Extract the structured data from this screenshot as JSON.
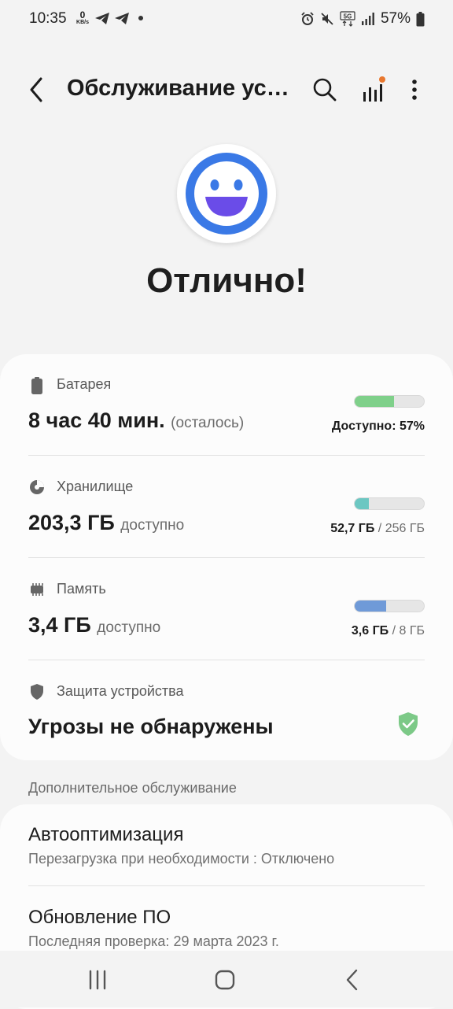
{
  "status_bar": {
    "time": "10:35",
    "net_speed": "0",
    "net_speed_unit": "KB/s",
    "network": "5G",
    "battery": "57%"
  },
  "header": {
    "title": "Обслуживание устройства",
    "stats_badge_color": "#e8772e"
  },
  "hero": {
    "status": "Отлично!",
    "face_ring_color": "#3a79e6",
    "face_mouth_color": "#6a4ce8"
  },
  "cards": {
    "battery": {
      "label": "Батарея",
      "value": "8 час 40 мин.",
      "value_suffix": "(осталось)",
      "detail": "Доступно: 57%",
      "fill_fraction": 0.57,
      "fill_color": "#7fd08a"
    },
    "storage": {
      "label": "Хранилище",
      "value": "203,3 ГБ",
      "value_suffix": "доступно",
      "used": "52,7 ГБ",
      "total": "/ 256 ГБ",
      "fill_fraction": 0.206,
      "fill_color": "#6cc7c2"
    },
    "memory": {
      "label": "Память",
      "value": "3,4 ГБ",
      "value_suffix": "доступно",
      "used": "3,6 ГБ",
      "total": "/ 8 ГБ",
      "fill_fraction": 0.45,
      "fill_color": "#6f9ad8"
    },
    "security": {
      "label": "Защита устройства",
      "value": "Угрозы не обнаружены",
      "shield_color": "#7cc987"
    }
  },
  "additional": {
    "section_title": "Дополнительное обслуживание",
    "items": [
      {
        "title": "Автооптимизация",
        "subtitle": "Перезагрузка при необходимости : Отключено"
      },
      {
        "title": "Обновление ПО",
        "subtitle": "Последняя проверка: 29 марта 2023 г."
      }
    ]
  }
}
